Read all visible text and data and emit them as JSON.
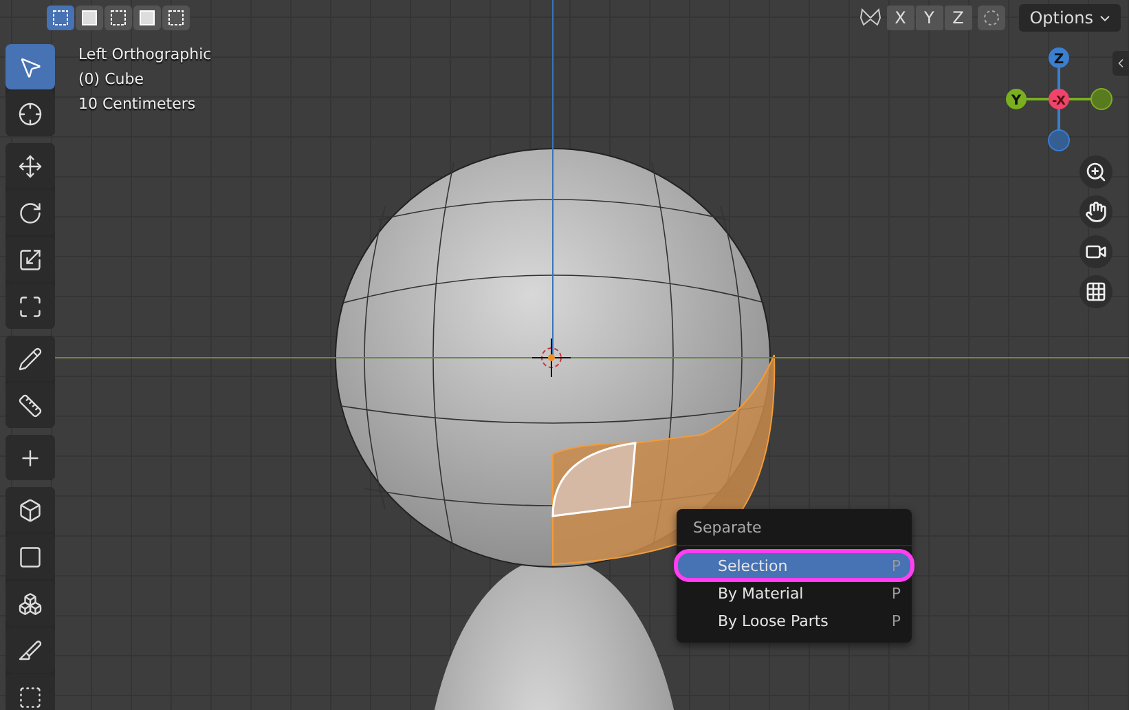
{
  "header": {
    "select_modes": [
      {
        "selected": true
      },
      {
        "selected": false
      },
      {
        "selected": false
      },
      {
        "selected": false
      },
      {
        "selected": false
      }
    ],
    "axes": [
      {
        "label": "X",
        "selected": false
      },
      {
        "label": "Y",
        "selected": false
      },
      {
        "label": "Z",
        "selected": false
      }
    ],
    "options": "Options"
  },
  "overlay_text": [
    "Left Orthographic",
    "(0) Cube",
    "10 Centimeters"
  ],
  "gizmo": {
    "z": "Z",
    "x": "-X",
    "y": "Y"
  },
  "tool_groups": [
    [
      {
        "kind": "select",
        "selected": true
      },
      {
        "kind": "cursor",
        "selected": false
      }
    ],
    [
      {
        "kind": "move",
        "selected": false
      },
      {
        "kind": "rotate",
        "selected": false
      },
      {
        "kind": "scale",
        "selected": false
      },
      {
        "kind": "transform",
        "selected": false
      }
    ],
    [
      {
        "kind": "annotate",
        "selected": false
      },
      {
        "kind": "measure",
        "selected": false
      }
    ],
    [
      {
        "kind": "add",
        "selected": false
      }
    ],
    [
      {
        "kind": "extrude",
        "selected": false
      },
      {
        "kind": "inset",
        "selected": false
      },
      {
        "kind": "bevel",
        "selected": false
      },
      {
        "kind": "loopcut",
        "selected": false
      },
      {
        "kind": "knife",
        "selected": false
      }
    ]
  ],
  "menu": {
    "title": "Separate",
    "items": [
      {
        "label": "Selection",
        "shortcut": "P",
        "selected": true
      },
      {
        "label": "By Material",
        "shortcut": "P",
        "selected": false
      },
      {
        "label": "By Loose Parts",
        "shortcut": "P",
        "selected": false
      }
    ]
  }
}
